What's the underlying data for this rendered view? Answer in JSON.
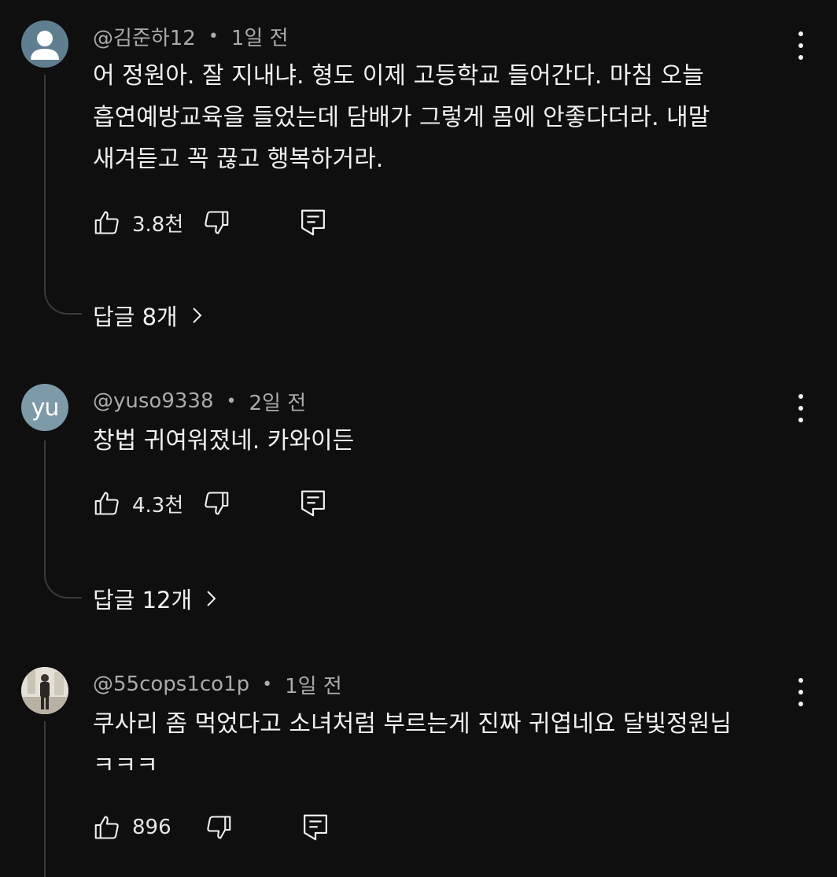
{
  "comments": [
    {
      "author": "@김준하12",
      "time": "1일 전",
      "lines": [
        "어 정원아. 잘 지내냐. 형도 이제 고등학교 들어간다. 마침 오늘",
        "흡연예방교육을 들었는데 담배가 그렇게 몸에 안좋다더라. 내말",
        "새겨듣고 꼭 끊고 행복하거라."
      ],
      "likes": "3.8천",
      "replies": "답글 8개",
      "avatar_type": "default-user-icon",
      "avatar_color": "#5f7f90"
    },
    {
      "author": "@yuso9338",
      "time": "2일 전",
      "lines": [
        "창법 귀여워졌네. 카와이든"
      ],
      "likes": "4.3천",
      "replies": "답글 12개",
      "avatar_initials": "yu",
      "avatar_color": "#7c9aa8"
    },
    {
      "author": "@55cops1co1p",
      "time": "1일 전",
      "lines": [
        "쿠사리 좀 먹었다고 소녀처럼 부르는게 진짜 귀엽네요 달빛정원님",
        "ㅋㅋㅋ"
      ],
      "likes": "896",
      "avatar_type": "photo-avatar"
    }
  ],
  "separator_dot": "•",
  "colors": {
    "background": "#0f0f0f",
    "text": "#f1f1f1",
    "meta": "#aaaaaa",
    "thread_line": "#3a3a3a"
  },
  "icons": [
    "like-icon",
    "dislike-icon",
    "reply-icon",
    "chevron-right-icon",
    "more-vert-icon"
  ]
}
